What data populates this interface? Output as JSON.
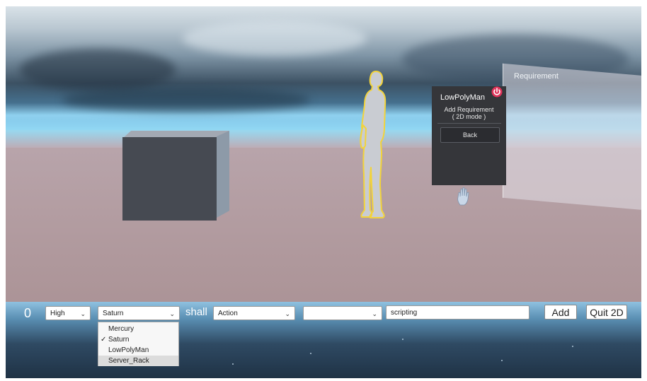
{
  "scene": {
    "requirement_panel_title": "Requirement",
    "menu": {
      "title": "LowPolyMan",
      "add_requirement_line1": "Add Requirement",
      "add_requirement_line2": "( 2D mode )",
      "back_label": "Back"
    }
  },
  "toolbar": {
    "score": "0",
    "priority_value": "High",
    "subject_value": "Saturn",
    "shall_label": "shall",
    "action_value": "Action",
    "object_value": "",
    "text_value": "scripting",
    "add_label": "Add",
    "quit_label": "Quit 2D"
  },
  "subject_dropdown": {
    "options": [
      "Mercury",
      "Saturn",
      "LowPolyMan",
      "Server_Rack"
    ],
    "checkmark": "✓"
  },
  "icons": {
    "power": "power-icon",
    "hand": "hand-icon",
    "chevron": "chevron-down-icon"
  },
  "colors": {
    "power_icon": "#e0325a",
    "figure_outline": "#f2d33b"
  }
}
